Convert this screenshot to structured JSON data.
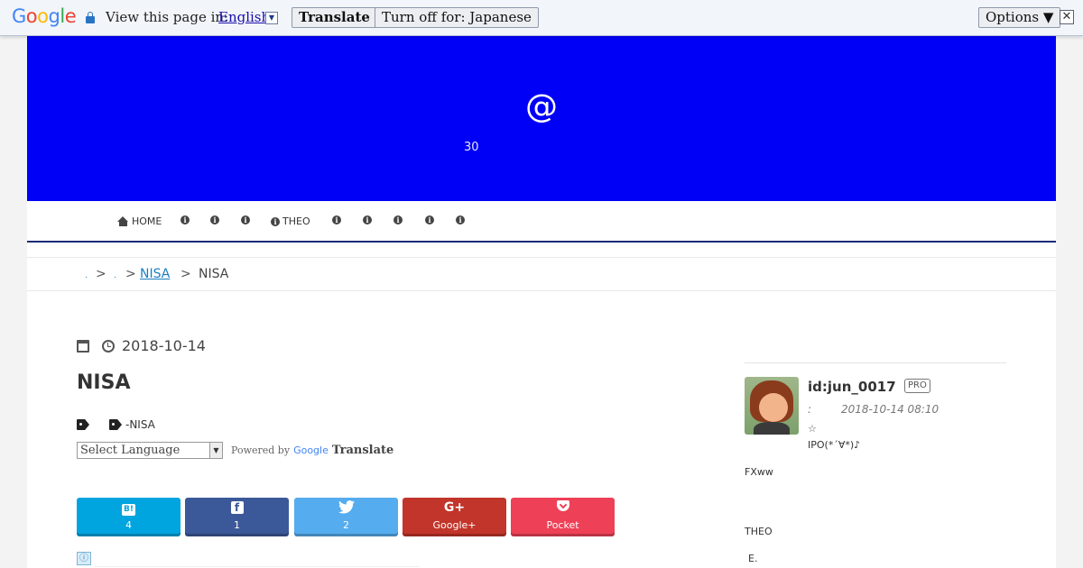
{
  "translate_bar": {
    "logo": [
      "G",
      "o",
      "o",
      "g",
      "l",
      "e"
    ],
    "view_label": "View this page in:",
    "language": "English",
    "translate_button": "Translate",
    "turn_off_button": "Turn off for: Japanese",
    "options_button": "Options ▼",
    "close_icon": "✕"
  },
  "header": {
    "site_title": "@",
    "site_description": "30"
  },
  "nav": {
    "items": [
      {
        "label": "HOME",
        "icon": "home-icon"
      },
      {
        "label": "",
        "icon": "info-icon"
      },
      {
        "label": "",
        "icon": "info-icon"
      },
      {
        "label": "",
        "icon": "info-icon"
      },
      {
        "label": "THEO",
        "icon": "info-icon"
      },
      {
        "label": "",
        "icon": "info-icon"
      },
      {
        "label": "",
        "icon": "info-icon"
      },
      {
        "label": "",
        "icon": "info-icon"
      },
      {
        "label": "",
        "icon": "info-icon"
      },
      {
        "label": "",
        "icon": "info-icon"
      }
    ]
  },
  "breadcrumb": {
    "items": [
      "",
      "",
      "NISA",
      "NISA"
    ],
    "separator": ">"
  },
  "article": {
    "date": "2018-10-14",
    "title": "NISA",
    "tags": [
      "",
      "-NISA"
    ],
    "language_select": "Select Language",
    "powered_by": "Powered by",
    "google": "Google",
    "translate": "Translate"
  },
  "share": {
    "buttons": [
      {
        "label": "4",
        "icon": "hatena-bookmark-icon",
        "glyph": "B!",
        "color": "#00a4de"
      },
      {
        "label": "1",
        "icon": "facebook-icon",
        "glyph": "f",
        "color": "#3b5998"
      },
      {
        "label": "2",
        "icon": "twitter-icon",
        "glyph": "🐦",
        "color": "#55acee"
      },
      {
        "label": "Google+",
        "icon": "google-plus-icon",
        "glyph": "G+",
        "color": "#c2352a"
      },
      {
        "label": "Pocket",
        "icon": "pocket-icon",
        "glyph": "",
        "color": "#ee4056"
      }
    ]
  },
  "sidebar": {
    "user_id": "id:jun_0017",
    "badge": "PRO",
    "colon": ":",
    "timestamp": "2018-10-14 08:10",
    "star": "☆",
    "line1": "IPO(*´∀*)♪",
    "line2": "FXww",
    "line3": "THEO",
    "line4": "E."
  }
}
